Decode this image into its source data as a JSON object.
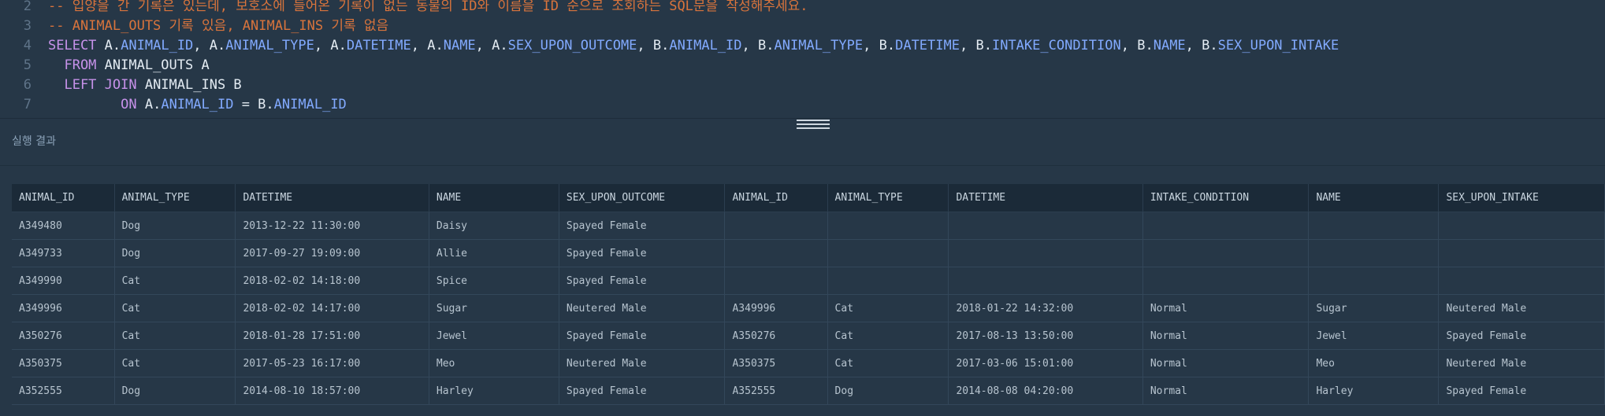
{
  "editor": {
    "lines": [
      {
        "num": "2",
        "tokens": [
          {
            "t": "-- 입양을 간 기록은 있는데, 보호소에 들어온 기록이 없는 동물의 ID와 이름을 ID 순으로 조회하는 SQL문을 작성해주세요.",
            "c": "cm"
          }
        ]
      },
      {
        "num": "3",
        "tokens": [
          {
            "t": "-- ANIMAL_OUTS 기록 있음, ANIMAL_INS 기록 없음",
            "c": "cm"
          }
        ]
      },
      {
        "num": "4",
        "tokens": [
          {
            "t": "SELECT ",
            "c": "kw"
          },
          {
            "t": "A",
            "c": "id"
          },
          {
            "t": ".",
            "c": "pn"
          },
          {
            "t": "ANIMAL_ID",
            "c": "col"
          },
          {
            "t": ", ",
            "c": "pn"
          },
          {
            "t": "A",
            "c": "id"
          },
          {
            "t": ".",
            "c": "pn"
          },
          {
            "t": "ANIMAL_TYPE",
            "c": "col"
          },
          {
            "t": ", ",
            "c": "pn"
          },
          {
            "t": "A",
            "c": "id"
          },
          {
            "t": ".",
            "c": "pn"
          },
          {
            "t": "DATETIME",
            "c": "col"
          },
          {
            "t": ", ",
            "c": "pn"
          },
          {
            "t": "A",
            "c": "id"
          },
          {
            "t": ".",
            "c": "pn"
          },
          {
            "t": "NAME",
            "c": "col"
          },
          {
            "t": ", ",
            "c": "pn"
          },
          {
            "t": "A",
            "c": "id"
          },
          {
            "t": ".",
            "c": "pn"
          },
          {
            "t": "SEX_UPON_OUTCOME",
            "c": "col"
          },
          {
            "t": ", ",
            "c": "pn"
          },
          {
            "t": "B",
            "c": "id"
          },
          {
            "t": ".",
            "c": "pn"
          },
          {
            "t": "ANIMAL_ID",
            "c": "col"
          },
          {
            "t": ", ",
            "c": "pn"
          },
          {
            "t": "B",
            "c": "id"
          },
          {
            "t": ".",
            "c": "pn"
          },
          {
            "t": "ANIMAL_TYPE",
            "c": "col"
          },
          {
            "t": ", ",
            "c": "pn"
          },
          {
            "t": "B",
            "c": "id"
          },
          {
            "t": ".",
            "c": "pn"
          },
          {
            "t": "DATETIME",
            "c": "col"
          },
          {
            "t": ", ",
            "c": "pn"
          },
          {
            "t": "B",
            "c": "id"
          },
          {
            "t": ".",
            "c": "pn"
          },
          {
            "t": "INTAKE_CONDITION",
            "c": "col"
          },
          {
            "t": ", ",
            "c": "pn"
          },
          {
            "t": "B",
            "c": "id"
          },
          {
            "t": ".",
            "c": "pn"
          },
          {
            "t": "NAME",
            "c": "col"
          },
          {
            "t": ", ",
            "c": "pn"
          },
          {
            "t": "B",
            "c": "id"
          },
          {
            "t": ".",
            "c": "pn"
          },
          {
            "t": "SEX_UPON_INTAKE",
            "c": "col"
          }
        ]
      },
      {
        "num": "5",
        "tokens": [
          {
            "t": "  FROM ",
            "c": "kw"
          },
          {
            "t": "ANIMAL_OUTS A",
            "c": "id"
          }
        ]
      },
      {
        "num": "6",
        "tokens": [
          {
            "t": "  LEFT JOIN ",
            "c": "kw"
          },
          {
            "t": "ANIMAL_INS B",
            "c": "id"
          }
        ]
      },
      {
        "num": "7",
        "tokens": [
          {
            "t": "         ON ",
            "c": "kw"
          },
          {
            "t": "A",
            "c": "id"
          },
          {
            "t": ".",
            "c": "pn"
          },
          {
            "t": "ANIMAL_ID",
            "c": "col"
          },
          {
            "t": " = ",
            "c": "pn"
          },
          {
            "t": "B",
            "c": "id"
          },
          {
            "t": ".",
            "c": "pn"
          },
          {
            "t": "ANIMAL_ID",
            "c": "col"
          }
        ]
      }
    ]
  },
  "result": {
    "title": "실행 결과",
    "columns": [
      "ANIMAL_ID",
      "ANIMAL_TYPE",
      "DATETIME",
      "NAME",
      "SEX_UPON_OUTCOME",
      "ANIMAL_ID",
      "ANIMAL_TYPE",
      "DATETIME",
      "INTAKE_CONDITION",
      "NAME",
      "SEX_UPON_INTAKE"
    ],
    "rows": [
      [
        "A349480",
        "Dog",
        "2013-12-22 11:30:00",
        "Daisy",
        "Spayed Female",
        "",
        "",
        "",
        "",
        "",
        ""
      ],
      [
        "A349733",
        "Dog",
        "2017-09-27 19:09:00",
        "Allie",
        "Spayed Female",
        "",
        "",
        "",
        "",
        "",
        ""
      ],
      [
        "A349990",
        "Cat",
        "2018-02-02 14:18:00",
        "Spice",
        "Spayed Female",
        "",
        "",
        "",
        "",
        "",
        ""
      ],
      [
        "A349996",
        "Cat",
        "2018-02-02 14:17:00",
        "Sugar",
        "Neutered Male",
        "A349996",
        "Cat",
        "2018-01-22 14:32:00",
        "Normal",
        "Sugar",
        "Neutered Male"
      ],
      [
        "A350276",
        "Cat",
        "2018-01-28 17:51:00",
        "Jewel",
        "Spayed Female",
        "A350276",
        "Cat",
        "2017-08-13 13:50:00",
        "Normal",
        "Jewel",
        "Spayed Female"
      ],
      [
        "A350375",
        "Cat",
        "2017-05-23 16:17:00",
        "Meo",
        "Neutered Male",
        "A350375",
        "Cat",
        "2017-03-06 15:01:00",
        "Normal",
        "Meo",
        "Neutered Male"
      ],
      [
        "A352555",
        "Dog",
        "2014-08-10 18:57:00",
        "Harley",
        "Spayed Female",
        "A352555",
        "Dog",
        "2014-08-08 04:20:00",
        "Normal",
        "Harley",
        "Spayed Female"
      ]
    ]
  }
}
